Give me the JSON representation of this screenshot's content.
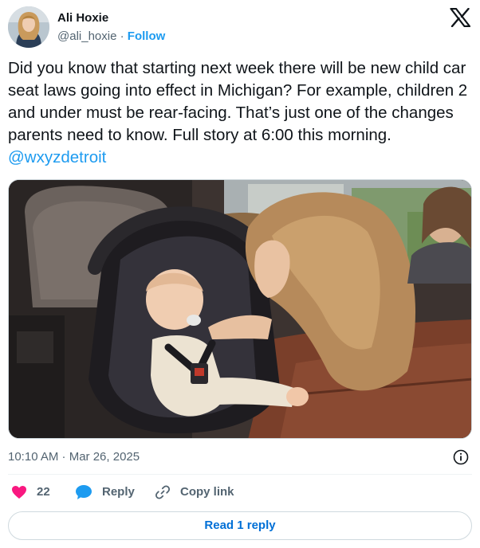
{
  "author": {
    "display_name": "Ali Hoxie",
    "handle": "@ali_hoxie",
    "separator": "·",
    "follow_label": "Follow"
  },
  "tweet": {
    "text_before": "Did you know that starting next week there will be new child car seat laws going into effect in Michigan? For example, children 2 and under must be rear-facing. That’s just one of the changes parents need to know. Full story at 6:00 this morning. ",
    "mention": "@wxyzdetroit"
  },
  "timestamp": "10:10 AM · Mar 26, 2025",
  "actions": {
    "likes_count": "22",
    "reply_label": "Reply",
    "copy_link_label": "Copy link"
  },
  "read_replies_label": "Read 1 reply",
  "colors": {
    "accent": "#1d9bf0",
    "like": "#f91880",
    "text": "#0f1419",
    "secondary": "#536471"
  },
  "icons": {
    "logo": "x-logo-icon",
    "info": "info-icon",
    "like": "heart-icon",
    "reply": "reply-bubble-icon",
    "copy": "link-icon"
  }
}
